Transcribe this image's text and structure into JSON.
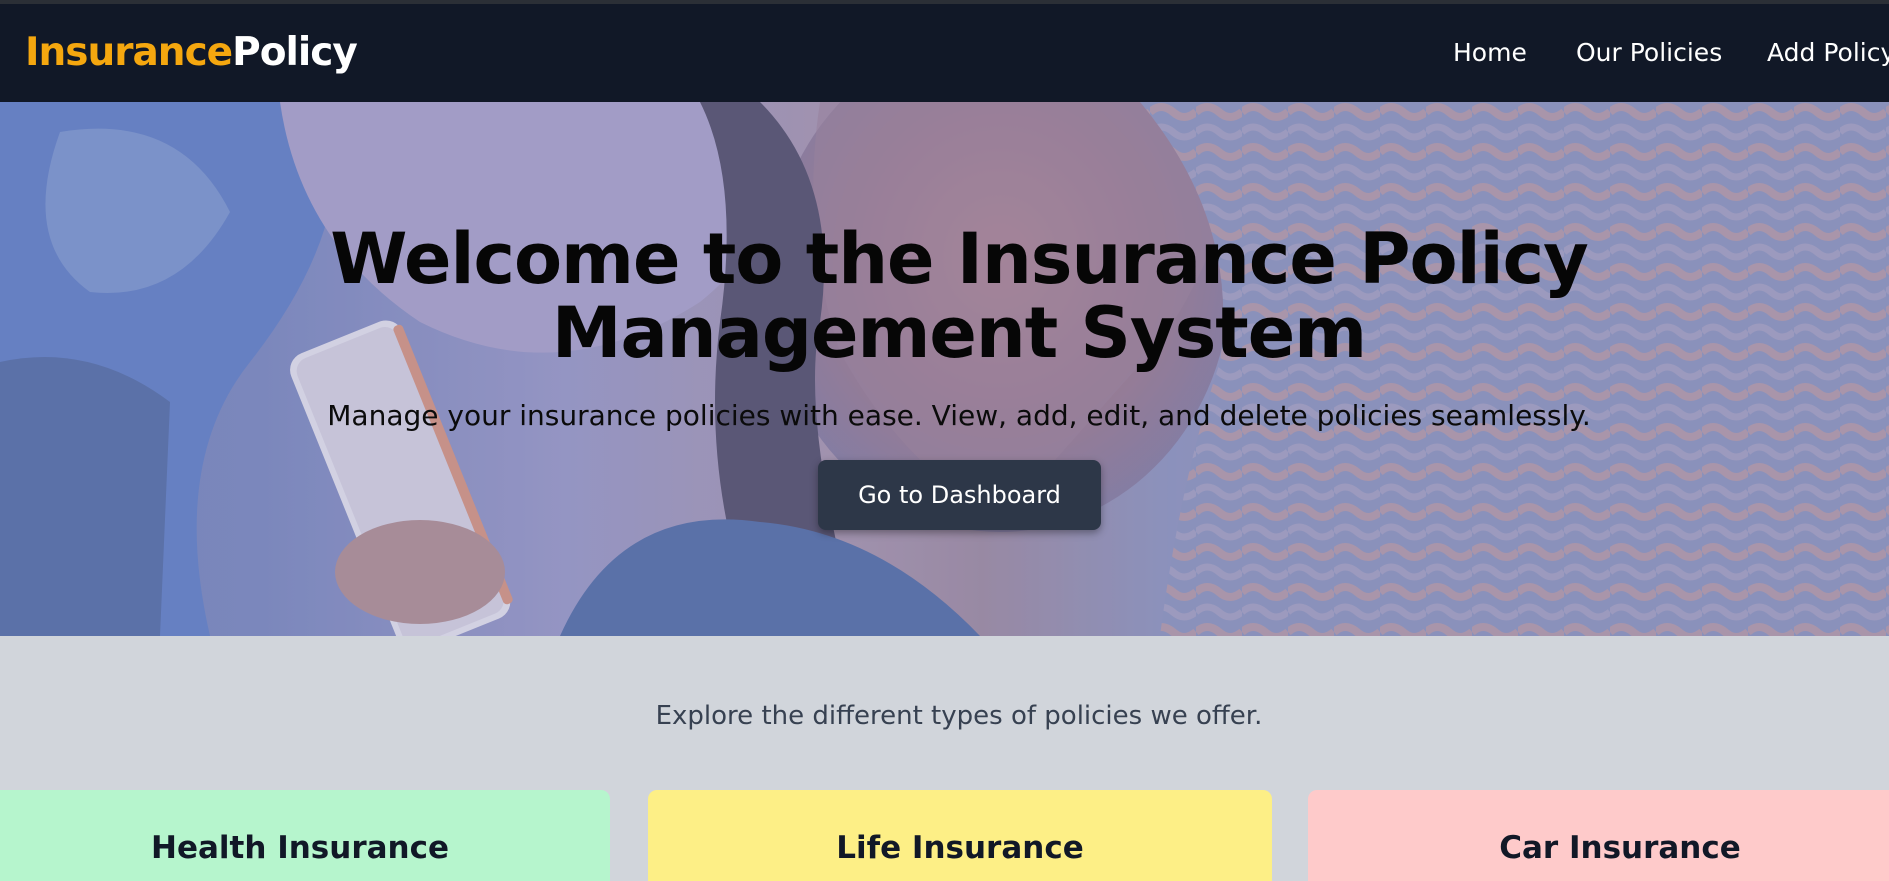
{
  "navbar": {
    "brand_part1": "Insurance",
    "brand_part2": "Policy",
    "links": [
      "Home",
      "Our Policies",
      "Add Policy"
    ]
  },
  "hero": {
    "title_line1": "Welcome to the Insurance Policy",
    "title_line2": "Management System",
    "subtitle": "Manage your insurance policies with ease. View, add, edit, and delete policies seamlessly.",
    "button_label": "Go to Dashboard"
  },
  "policies": {
    "intro": "Explore the different types of policies we offer.",
    "cards": [
      {
        "title": "Health Insurance",
        "color": "#b6f5cd"
      },
      {
        "title": "Life Insurance",
        "color": "#fdef86"
      },
      {
        "title": "Car Insurance",
        "color": "#fecaca"
      }
    ]
  },
  "colors": {
    "navbar_bg": "#111827",
    "brand_accent": "#f5a70f",
    "button_bg": "#2d3748",
    "page_bg": "#d1d5db"
  }
}
